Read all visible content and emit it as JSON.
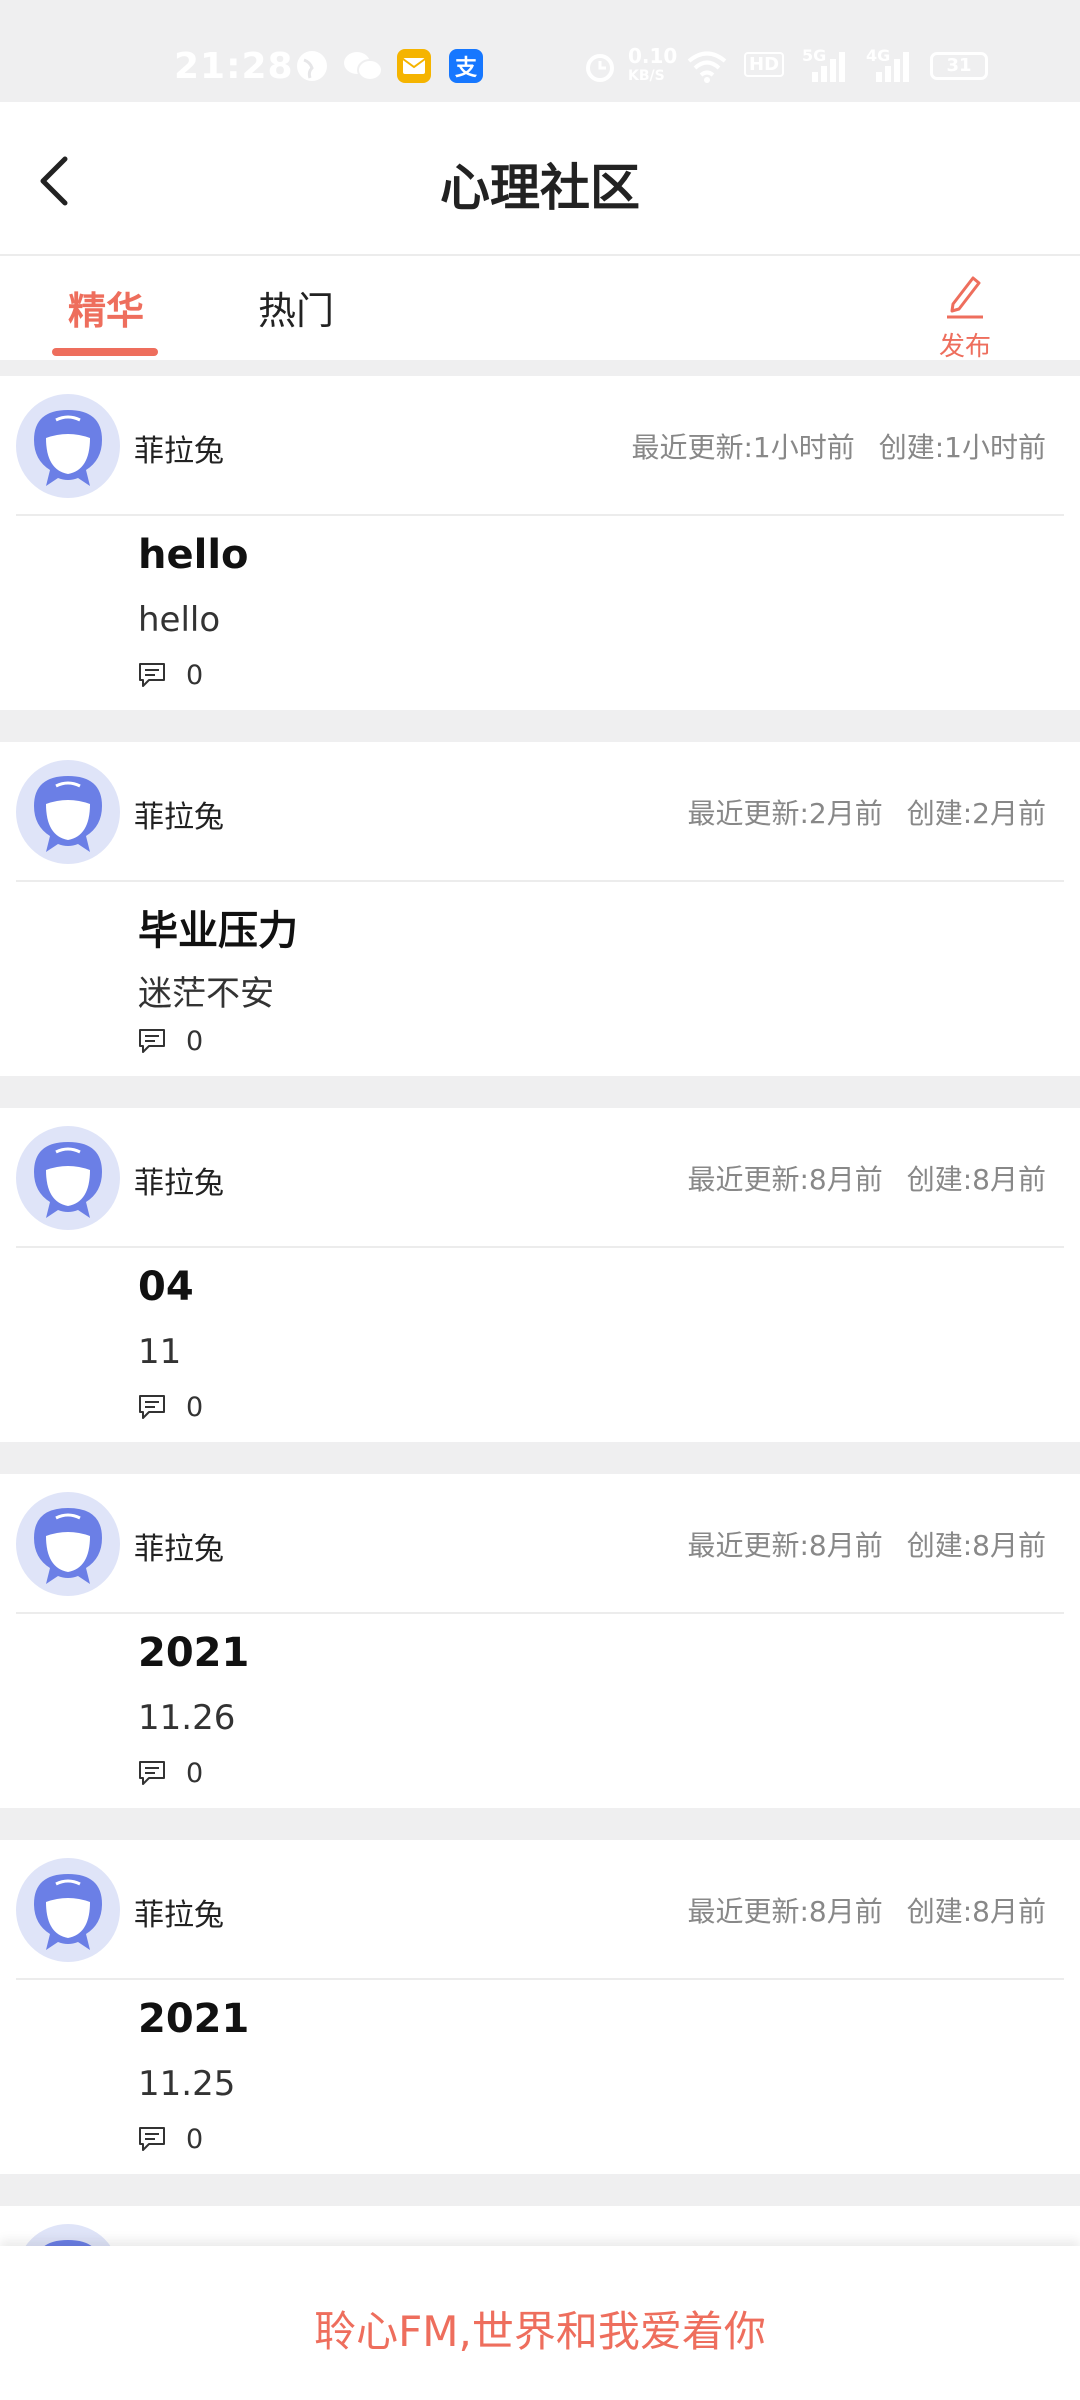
{
  "status_bar": {
    "time": "21:28",
    "network_speed": "0.10",
    "network_unit": "KB/S",
    "hd_badge": "HD",
    "signal_1": "5G",
    "signal_2": "4G",
    "battery": "31"
  },
  "header": {
    "title": "心理社区",
    "back_icon": "chevron-left-icon"
  },
  "tabs": [
    {
      "label": "精华",
      "active": true
    },
    {
      "label": "热门",
      "active": false
    }
  ],
  "publish": {
    "label": "发布",
    "icon": "pencil-icon"
  },
  "posts": [
    {
      "author": "菲拉兔",
      "updated": "最近更新:1小时前",
      "created": "创建:1小时前",
      "title": "hello",
      "body": "hello",
      "comments": "0"
    },
    {
      "author": "菲拉兔",
      "updated": "最近更新:2月前",
      "created": "创建:2月前",
      "title": "毕业压力",
      "body": "迷茫不安",
      "comments": "0"
    },
    {
      "author": "菲拉兔",
      "updated": "最近更新:8月前",
      "created": "创建:8月前",
      "title": "04",
      "body": "11",
      "comments": "0"
    },
    {
      "author": "菲拉兔",
      "updated": "最近更新:8月前",
      "created": "创建:8月前",
      "title": "2021",
      "body": "11.26",
      "comments": "0"
    },
    {
      "author": "菲拉兔",
      "updated": "最近更新:8月前",
      "created": "创建:8月前",
      "title": "2021",
      "body": "11.25",
      "comments": "0"
    }
  ],
  "bottom_banner": {
    "slogan": "聆心FM,世界和我爱着你"
  },
  "colors": {
    "accent": "#ee6e5d",
    "background": "#efeff0",
    "avatar_blue": "#6b7fe6",
    "meta_gray": "#888888"
  }
}
